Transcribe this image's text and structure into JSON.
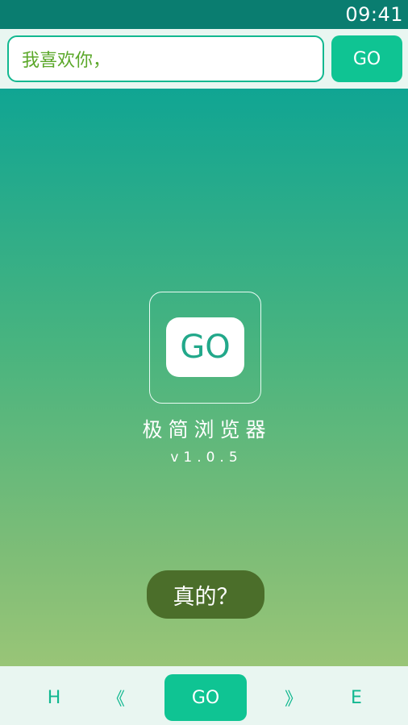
{
  "status_bar": {
    "time": "09:41"
  },
  "top_bar": {
    "url_value": "我喜欢你，",
    "go_label": "GO"
  },
  "main": {
    "logo_text": "GO",
    "app_name": "极简浏览器",
    "version": "v1.0.5",
    "toast": "真的？"
  },
  "bottom_bar": {
    "home_label": "H",
    "back_label": "《",
    "go_label": "GO",
    "forward_label": "》",
    "end_label": "E"
  },
  "colors": {
    "status_bar": "#0a7d70",
    "accent": "#0fc493",
    "toast_bg": "#4b6e2a",
    "input_text": "#5ba82a"
  }
}
